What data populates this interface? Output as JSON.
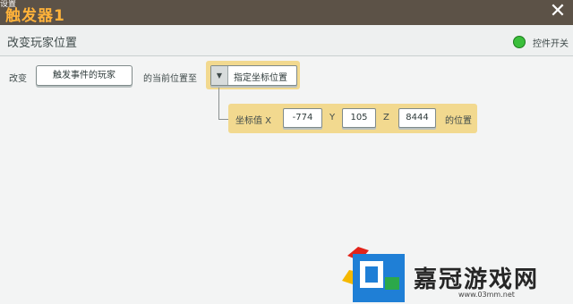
{
  "window": {
    "title": "触发器1",
    "subtitle": "设置",
    "close_icon": "close-x"
  },
  "header": {
    "title": "改变玩家位置",
    "switch_label": "控件开关",
    "switch_color": "#3bbf3b"
  },
  "row1": {
    "prefix": "改变",
    "target_button": "触发事件的玩家",
    "middle": "的当前位置至",
    "dropdown_value": "指定坐标位置"
  },
  "row2": {
    "label": "坐标值 X",
    "x_value": "-774",
    "y_label": "Y",
    "y_value": "105",
    "z_label": "Z",
    "z_value": "8444",
    "suffix": "的位置"
  },
  "watermark": {
    "text": "嘉冠游戏网",
    "url": "www.03mm.net"
  },
  "colors": {
    "titlebar": "#5c5247",
    "title_text": "#ffb23a",
    "highlight": "#f2d98f"
  }
}
